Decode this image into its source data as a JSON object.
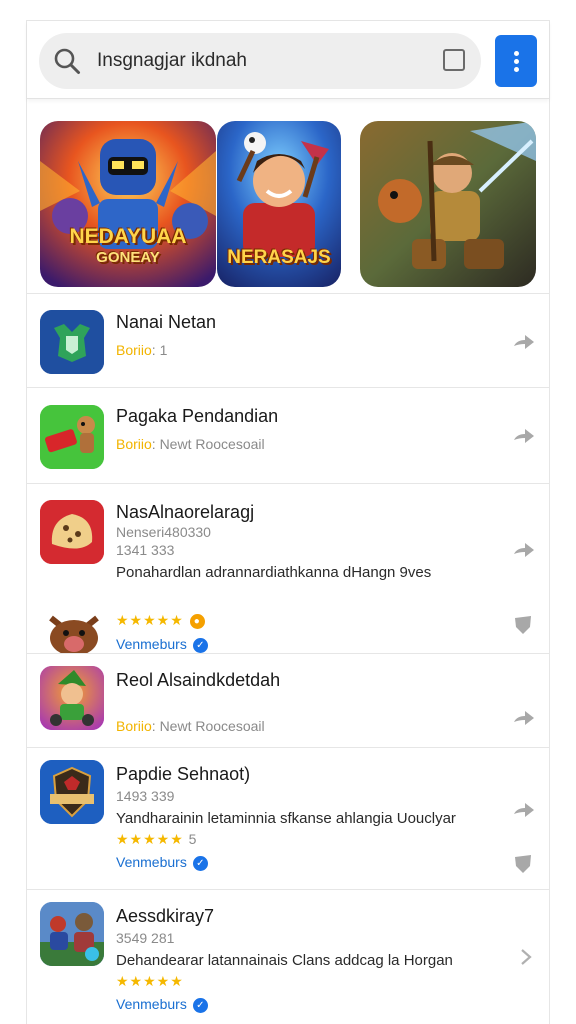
{
  "search": {
    "query": "Insgnagjar ikdnah",
    "search_icon": "search-icon",
    "checkbox_icon": "square-icon",
    "menu_icon": "more-vert-icon",
    "accent": "#1a73e8"
  },
  "banners": [
    {
      "title": "NEDAYUAA",
      "subtitle": "GONEAY"
    },
    {
      "title": "NERASAJS"
    },
    {
      "title": ""
    }
  ],
  "apps": [
    {
      "name": "Nanai Netan",
      "tag": "Boriio",
      "meta": ": 1"
    },
    {
      "name": "Pagaka Pendandian",
      "tag": "Boriio",
      "meta": ": Newt Roocesoail"
    },
    {
      "name": "NasAlnaorelaragj",
      "line2": "Nenseri480330",
      "line3": "1341 333",
      "desc": "Ponahardlan adrannardiathkanna dHangn 9ves",
      "stars": "★★★★★",
      "developer": "Venmeburs"
    },
    {
      "name": "Reol Alsaindkdetdah",
      "tag": "Boriio",
      "meta": ": Newt Roocesoail"
    },
    {
      "name": "Papdie Sehnaot)",
      "line2": "1493 339",
      "desc": "Yandharainin letaminnia sfkanse ahlangia Uouclyar",
      "stars": "★★★★★",
      "rating": "5",
      "developer": "Venmeburs"
    },
    {
      "name": "Aessdkiray7",
      "line2": "3549 281",
      "desc": "Dehandearar latannainais Clans addcag la Horgan",
      "stars": "★★★★★",
      "developer": "Venmeburs"
    }
  ],
  "colors": {
    "tag": "#f2b400",
    "developer": "#1a6fd1",
    "stars": "#f5b800"
  }
}
